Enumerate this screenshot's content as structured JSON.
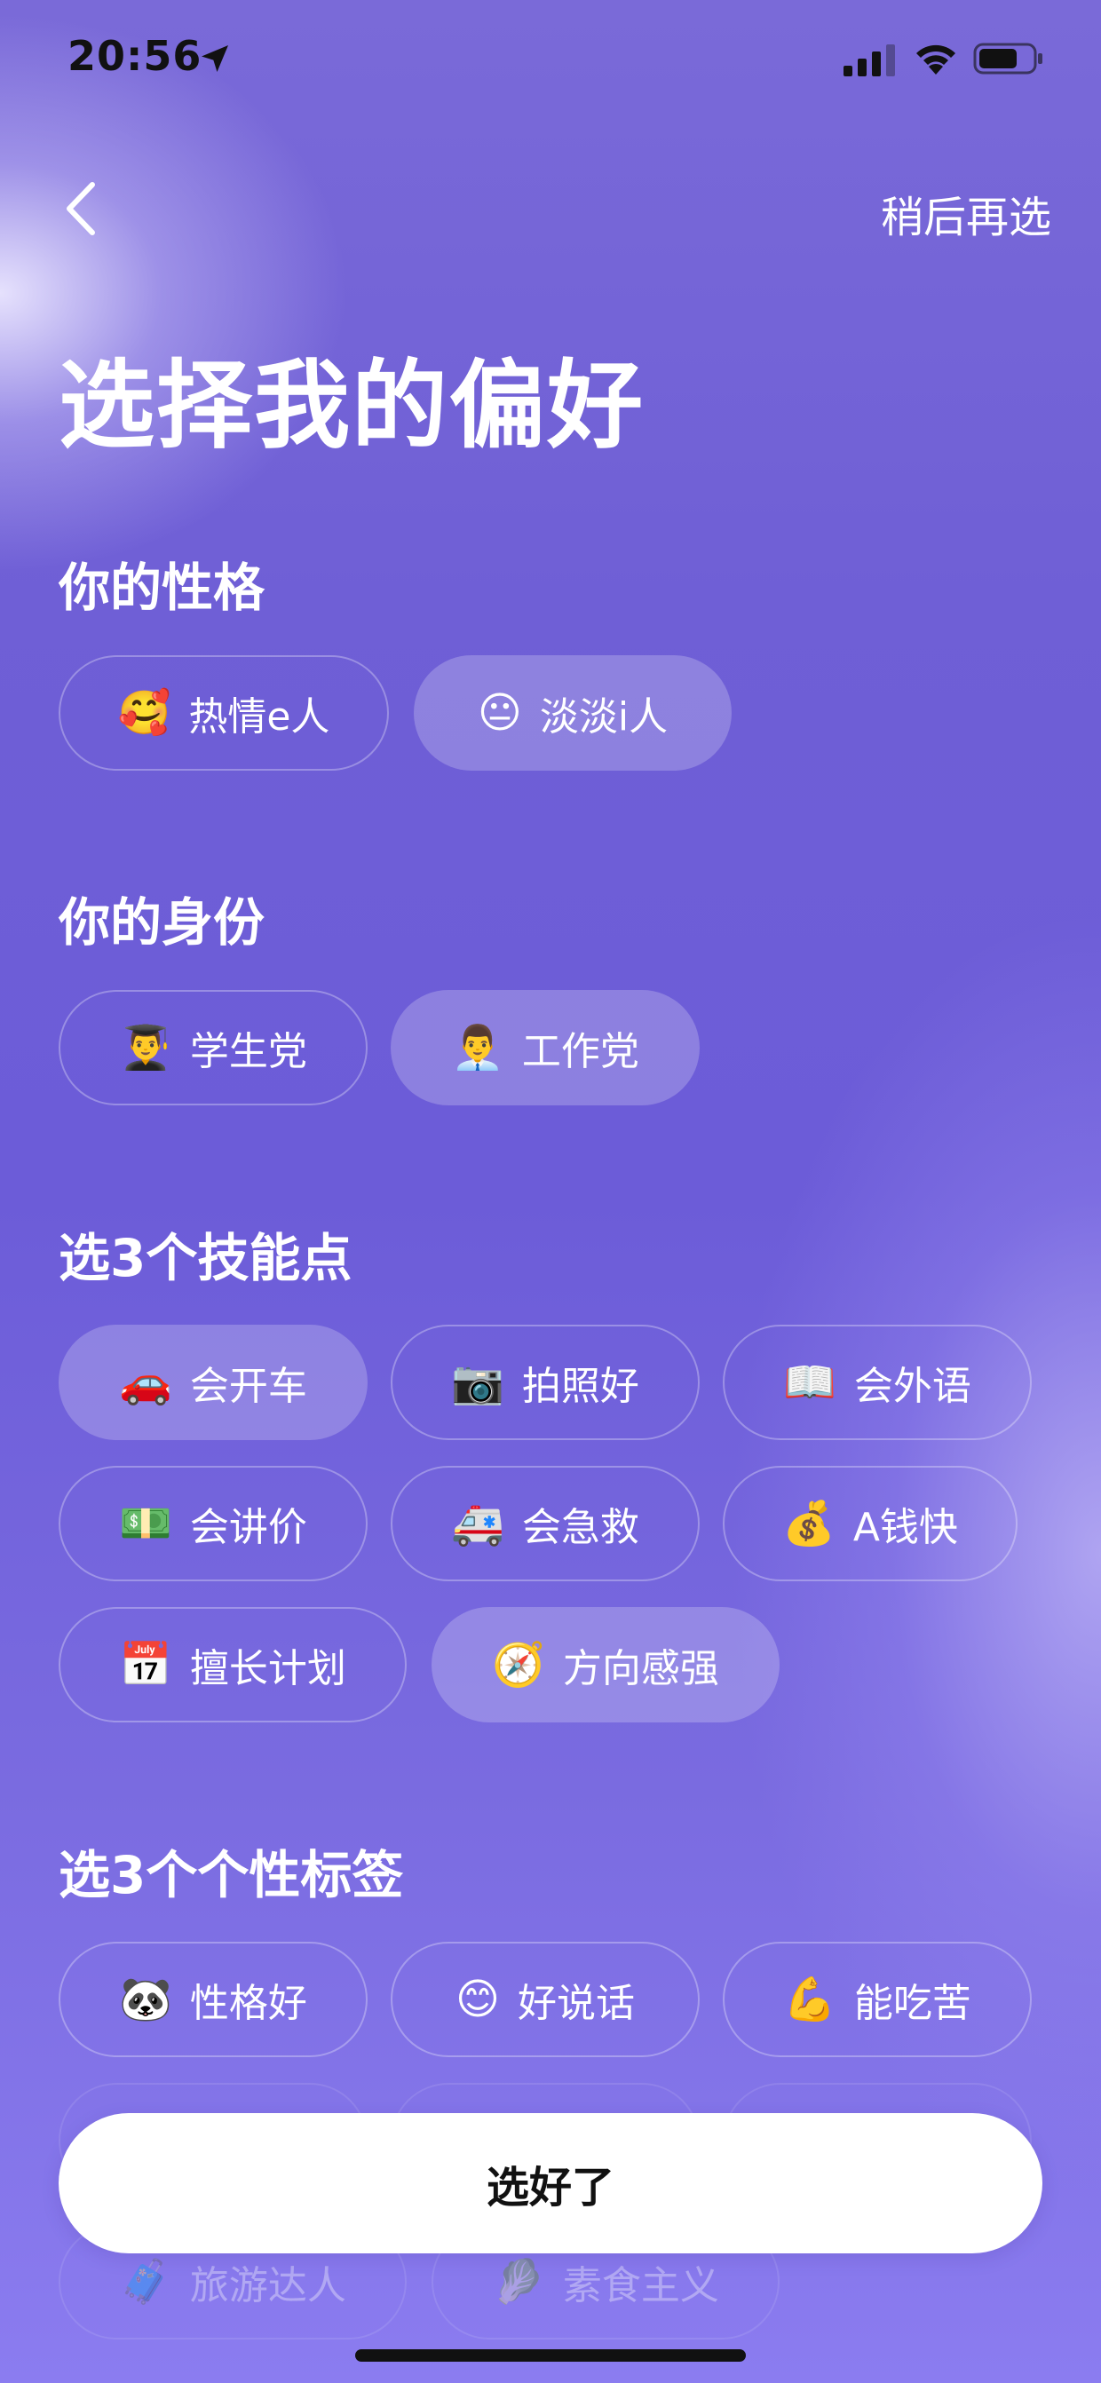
{
  "status_bar": {
    "time": "20:56"
  },
  "header": {
    "later_label": "稍后再选"
  },
  "title": "选择我的偏好",
  "sections": {
    "personality": {
      "title": "你的性格",
      "options": [
        {
          "emoji": "🥰",
          "label": "热情e人",
          "selected": false
        },
        {
          "emoji": "😐",
          "label": "淡淡i人",
          "selected": true
        }
      ]
    },
    "identity": {
      "title": "你的身份",
      "options": [
        {
          "emoji": "👨‍🎓",
          "label": "学生党",
          "selected": false
        },
        {
          "emoji": "👨‍💼",
          "label": "工作党",
          "selected": true
        }
      ]
    },
    "skills": {
      "title": "选3个技能点",
      "options": [
        {
          "emoji": "🚗",
          "label": "会开车",
          "selected": true
        },
        {
          "emoji": "📷",
          "label": "拍照好",
          "selected": false
        },
        {
          "emoji": "📖",
          "label": "会外语",
          "selected": false
        },
        {
          "emoji": "💵",
          "label": "会讲价",
          "selected": false
        },
        {
          "emoji": "🚑",
          "label": "会急救",
          "selected": false
        },
        {
          "emoji": "💰",
          "label": "A钱快",
          "selected": false
        },
        {
          "emoji": "📅",
          "label": "擅长计划",
          "selected": false
        },
        {
          "emoji": "🧭",
          "label": "方向感强",
          "selected": true
        }
      ]
    },
    "tags": {
      "title": "选3个个性标签",
      "options": [
        {
          "emoji": "🐼",
          "label": "性格好",
          "selected": false
        },
        {
          "emoji": "😊",
          "label": "好说话",
          "selected": false
        },
        {
          "emoji": "💪",
          "label": "能吃苦",
          "selected": false
        },
        {
          "emoji": "🧳",
          "label": "旅游达人",
          "selected": false
        },
        {
          "emoji": "🥬",
          "label": "素食主义",
          "selected": false
        }
      ]
    }
  },
  "done_button": {
    "label": "选好了"
  }
}
